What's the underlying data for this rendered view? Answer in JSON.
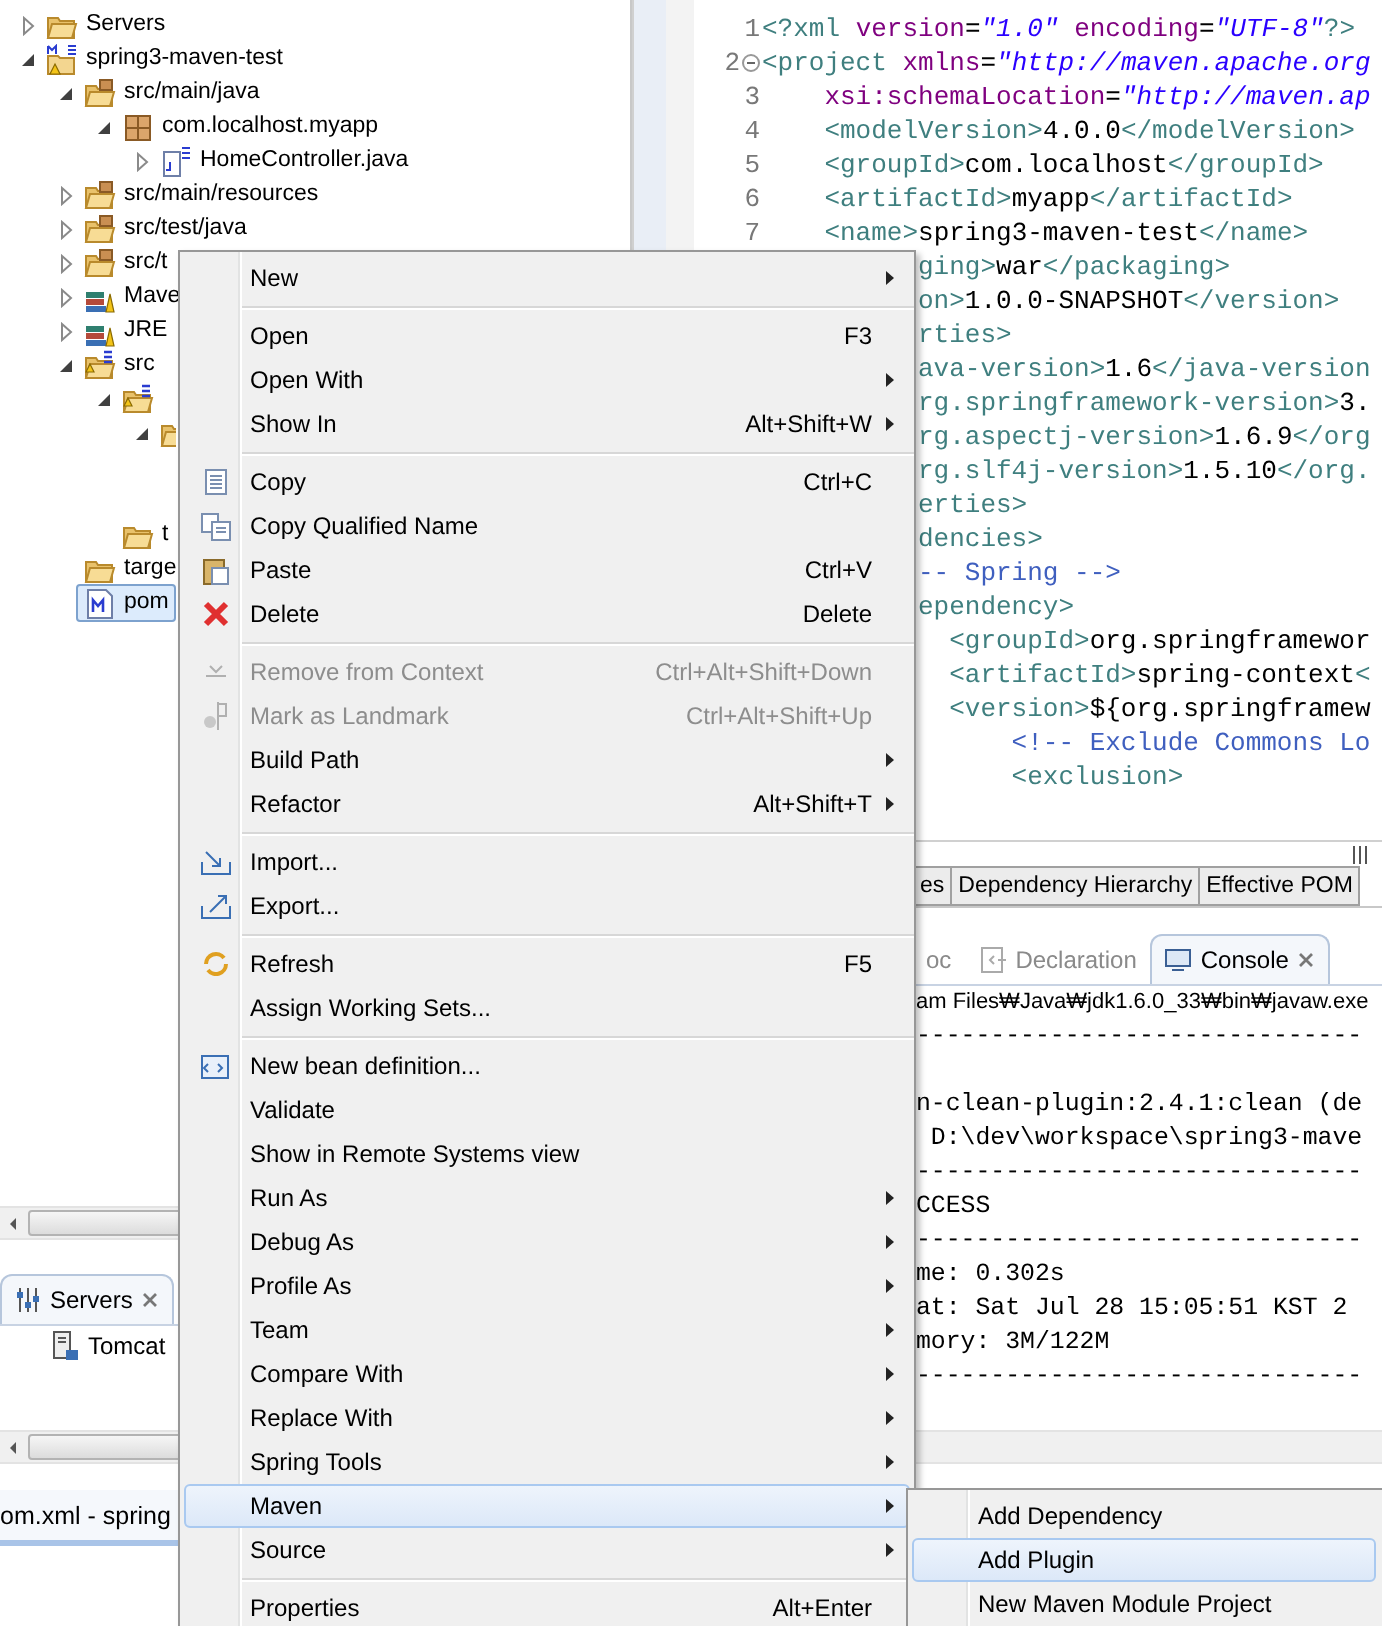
{
  "project_explorer": {
    "tree": [
      {
        "label": "Servers",
        "kind": "folder",
        "expanded": false,
        "selected": false
      },
      {
        "label": "spring3-maven-test",
        "kind": "project",
        "expanded": true,
        "selected": false,
        "children": [
          {
            "label": "src/main/java",
            "kind": "source-folder",
            "expanded": true,
            "selected": false,
            "children": [
              {
                "label": "com.localhost.myapp",
                "kind": "package",
                "expanded": true,
                "selected": false,
                "children": [
                  {
                    "label": "HomeController.java",
                    "kind": "java",
                    "expanded": false,
                    "selected": false
                  }
                ]
              }
            ]
          },
          {
            "label": "src/main/resources",
            "kind": "source-folder",
            "expanded": false,
            "selected": false
          },
          {
            "label": "src/test/java",
            "kind": "source-folder",
            "expanded": false,
            "selected": false
          },
          {
            "label": "src/t",
            "kind": "source-folder",
            "expanded": false,
            "selected": false
          },
          {
            "label": "Mave",
            "kind": "library",
            "expanded": false,
            "selected": false
          },
          {
            "label": "JRE",
            "kind": "library",
            "expanded": false,
            "selected": false
          },
          {
            "label": "src",
            "kind": "spring-folder",
            "expanded": true,
            "selected": false,
            "children": [
              {
                "kind": "spring-folder",
                "expanded": true,
                "selected": false,
                "children": [
                  {
                    "kind": "folder",
                    "expanded": true,
                    "selected": false
                  }
                ]
              },
              {
                "label": "t",
                "kind": "folder",
                "selected": false,
                "spacer_before": true
              }
            ]
          },
          {
            "label": "targe",
            "kind": "folder",
            "selected": false
          },
          {
            "label": "pom",
            "kind": "pom",
            "selected": true
          }
        ]
      }
    ]
  },
  "servers_view": {
    "tab": {
      "label": "Servers",
      "selected": true
    },
    "items": [
      {
        "label": "Tomcat"
      }
    ]
  },
  "editor": {
    "lines": [
      {
        "number": "1",
        "segments": [
          {
            "kind": "tag",
            "text": "<?xml"
          },
          {
            "kind": "attr",
            "text": " version"
          },
          {
            "kind": "text",
            "text": "="
          },
          {
            "kind": "value",
            "text": "\"1.0\""
          },
          {
            "kind": "attr",
            "text": " encoding"
          },
          {
            "kind": "text",
            "text": "="
          },
          {
            "kind": "value",
            "text": "\"UTF-8\""
          },
          {
            "kind": "tag",
            "text": "?>"
          }
        ]
      },
      {
        "number": "2",
        "expanded": true,
        "segments": [
          {
            "kind": "tag",
            "text": "<project"
          },
          {
            "kind": "attr",
            "text": " xmlns"
          },
          {
            "kind": "text",
            "text": "="
          },
          {
            "kind": "value",
            "text": "\"http://maven.apache.org"
          }
        ]
      },
      {
        "number": "3",
        "segments": [
          {
            "kind": "attr",
            "text": "    xsi:schemaLocation"
          },
          {
            "kind": "text",
            "text": "="
          },
          {
            "kind": "value",
            "text": "\"http://maven.ap"
          }
        ]
      },
      {
        "number": "4",
        "segments": [
          {
            "kind": "tag",
            "text": "    <modelVersion>"
          },
          {
            "kind": "text",
            "text": "4.0.0"
          },
          {
            "kind": "tag",
            "text": "</modelVersion>"
          }
        ]
      },
      {
        "number": "5",
        "segments": [
          {
            "kind": "tag",
            "text": "    <groupId>"
          },
          {
            "kind": "text",
            "text": "com.localhost"
          },
          {
            "kind": "tag",
            "text": "</groupId>"
          }
        ]
      },
      {
        "number": "6",
        "segments": [
          {
            "kind": "tag",
            "text": "    <artifactId>"
          },
          {
            "kind": "text",
            "text": "myapp"
          },
          {
            "kind": "tag",
            "text": "</artifactId>"
          }
        ]
      },
      {
        "number": "7",
        "segments": [
          {
            "kind": "tag",
            "text": "    <name>"
          },
          {
            "kind": "text",
            "text": "spring3-maven-test"
          },
          {
            "kind": "tag",
            "text": "</name>"
          }
        ]
      },
      {
        "segments": [
          {
            "kind": "tag",
            "text": "ging>"
          },
          {
            "kind": "text",
            "text": "war"
          },
          {
            "kind": "tag",
            "text": "</packaging>"
          }
        ]
      },
      {
        "segments": [
          {
            "kind": "tag",
            "text": "on>"
          },
          {
            "kind": "text",
            "text": "1.0.0-SNAPSHOT"
          },
          {
            "kind": "tag",
            "text": "</version>"
          }
        ]
      },
      {
        "segments": [
          {
            "kind": "tag",
            "text": "rties>"
          }
        ]
      },
      {
        "segments": [
          {
            "kind": "tag",
            "text": "ava-version>"
          },
          {
            "kind": "text",
            "text": "1.6"
          },
          {
            "kind": "tag",
            "text": "</java-version"
          }
        ]
      },
      {
        "segments": [
          {
            "kind": "tag",
            "text": "rg.springframework-version>"
          },
          {
            "kind": "text",
            "text": "3."
          }
        ]
      },
      {
        "segments": [
          {
            "kind": "tag",
            "text": "rg.aspectj-version>"
          },
          {
            "kind": "text",
            "text": "1.6.9"
          },
          {
            "kind": "tag",
            "text": "</org"
          }
        ]
      },
      {
        "segments": [
          {
            "kind": "tag",
            "text": "rg.slf4j-version>"
          },
          {
            "kind": "text",
            "text": "1.5.10"
          },
          {
            "kind": "tag",
            "text": "</org."
          }
        ]
      },
      {
        "segments": [
          {
            "kind": "tag",
            "text": "erties>"
          }
        ]
      },
      {
        "segments": [
          {
            "kind": "tag",
            "text": "dencies>"
          }
        ]
      },
      {
        "segments": [
          {
            "kind": "comment",
            "text": "-- Spring -->"
          }
        ]
      },
      {
        "segments": [
          {
            "kind": "tag",
            "text": "ependency>"
          }
        ]
      },
      {
        "segments": [
          {
            "kind": "tag",
            "text": "  <groupId>"
          },
          {
            "kind": "text",
            "text": "org.springframewor"
          }
        ]
      },
      {
        "segments": [
          {
            "kind": "tag",
            "text": "  <artifactId>"
          },
          {
            "kind": "text",
            "text": "spring-context"
          },
          {
            "kind": "tag",
            "text": "<"
          }
        ]
      },
      {
        "segments": [
          {
            "kind": "tag",
            "text": "  <version>"
          },
          {
            "kind": "text",
            "text": "${org.springframew"
          }
        ]
      },
      {
        "segments": [
          {
            "kind": "comment",
            "text": "      <!-- Exclude Commons Lo"
          }
        ]
      },
      {
        "segments": [
          {
            "kind": "tag",
            "text": "      <exclusion>"
          }
        ]
      }
    ],
    "tabs": [
      {
        "label": "es",
        "selected": false
      },
      {
        "label": "Dependency Hierarchy",
        "selected": false
      },
      {
        "label": "Effective POM",
        "selected": false
      }
    ]
  },
  "views": {
    "tabs": [
      {
        "label": "oc",
        "selected": false
      },
      {
        "label": "Declaration",
        "selected": false
      },
      {
        "label": "Console",
        "selected": true
      }
    ],
    "console_header": "am Files₩Java₩jdk1.6.0_33₩bin₩javaw.exe",
    "console_lines": [
      {
        "kind": "text",
        "text": "------------------------------"
      },
      {
        "kind": "blank"
      },
      {
        "kind": "text",
        "text": "n-clean-plugin:2.4.1:clean (de"
      },
      {
        "kind": "text",
        "text": " D:\\dev\\workspace\\spring3-mave"
      },
      {
        "kind": "text",
        "text": "------------------------------"
      },
      {
        "kind": "text",
        "text": "CCESS"
      },
      {
        "kind": "text",
        "text": "------------------------------"
      },
      {
        "kind": "text",
        "text": "me: 0.302s"
      },
      {
        "kind": "text",
        "text": "at: Sat Jul 28 15:05:51 KST 2"
      },
      {
        "kind": "text",
        "text": "mory: 3M/122M"
      },
      {
        "kind": "text",
        "text": "------------------------------"
      }
    ]
  },
  "status_bar": {
    "text": "om.xml - spring"
  },
  "context_menu": {
    "items": [
      {
        "kind": "item",
        "label": "New",
        "submenu": true,
        "disabled": false,
        "selected": false
      },
      {
        "kind": "separator"
      },
      {
        "kind": "item",
        "label": "Open",
        "shortcut": "F3",
        "submenu": false,
        "disabled": false,
        "selected": false
      },
      {
        "kind": "item",
        "label": "Open With",
        "submenu": true,
        "disabled": false,
        "selected": false
      },
      {
        "kind": "item",
        "label": "Show In",
        "shortcut": "Alt+Shift+W",
        "submenu": true,
        "disabled": false,
        "selected": false
      },
      {
        "kind": "separator"
      },
      {
        "kind": "item",
        "label": "Copy",
        "shortcut": "Ctrl+C",
        "submenu": false,
        "disabled": false,
        "selected": false
      },
      {
        "kind": "item",
        "label": "Copy Qualified Name",
        "submenu": false,
        "disabled": false,
        "selected": false
      },
      {
        "kind": "item",
        "label": "Paste",
        "shortcut": "Ctrl+V",
        "submenu": false,
        "disabled": false,
        "selected": false
      },
      {
        "kind": "item",
        "label": "Delete",
        "shortcut": "Delete",
        "submenu": false,
        "disabled": false,
        "selected": false
      },
      {
        "kind": "separator"
      },
      {
        "kind": "item",
        "label": "Remove from Context",
        "shortcut": "Ctrl+Alt+Shift+Down",
        "submenu": false,
        "disabled": true,
        "selected": false
      },
      {
        "kind": "item",
        "label": "Mark as Landmark",
        "shortcut": "Ctrl+Alt+Shift+Up",
        "submenu": false,
        "disabled": true,
        "selected": false
      },
      {
        "kind": "item",
        "label": "Build Path",
        "submenu": true,
        "disabled": false,
        "selected": false
      },
      {
        "kind": "item",
        "label": "Refactor",
        "shortcut": "Alt+Shift+T",
        "submenu": true,
        "disabled": false,
        "selected": false
      },
      {
        "kind": "separator"
      },
      {
        "kind": "item",
        "label": "Import...",
        "submenu": false,
        "disabled": false,
        "selected": false
      },
      {
        "kind": "item",
        "label": "Export...",
        "submenu": false,
        "disabled": false,
        "selected": false
      },
      {
        "kind": "separator"
      },
      {
        "kind": "item",
        "label": "Refresh",
        "shortcut": "F5",
        "submenu": false,
        "disabled": false,
        "selected": false
      },
      {
        "kind": "item",
        "label": "Assign Working Sets...",
        "submenu": false,
        "disabled": false,
        "selected": false
      },
      {
        "kind": "separator"
      },
      {
        "kind": "item",
        "label": "New bean definition...",
        "submenu": false,
        "disabled": false,
        "selected": false
      },
      {
        "kind": "item",
        "label": "Validate",
        "submenu": false,
        "disabled": false,
        "selected": false
      },
      {
        "kind": "item",
        "label": "Show in Remote Systems view",
        "submenu": false,
        "disabled": false,
        "selected": false
      },
      {
        "kind": "item",
        "label": "Run As",
        "submenu": true,
        "disabled": false,
        "selected": false
      },
      {
        "kind": "item",
        "label": "Debug As",
        "submenu": true,
        "disabled": false,
        "selected": false
      },
      {
        "kind": "item",
        "label": "Profile As",
        "submenu": true,
        "disabled": false,
        "selected": false
      },
      {
        "kind": "item",
        "label": "Team",
        "submenu": true,
        "disabled": false,
        "selected": false
      },
      {
        "kind": "item",
        "label": "Compare With",
        "submenu": true,
        "disabled": false,
        "selected": false
      },
      {
        "kind": "item",
        "label": "Replace With",
        "submenu": true,
        "disabled": false,
        "selected": false
      },
      {
        "kind": "item",
        "label": "Spring Tools",
        "submenu": true,
        "disabled": false,
        "selected": false
      },
      {
        "kind": "item",
        "label": "Maven",
        "submenu": true,
        "disabled": false,
        "selected": true
      },
      {
        "kind": "item",
        "label": "Source",
        "submenu": true,
        "disabled": false,
        "selected": false
      },
      {
        "kind": "separator"
      },
      {
        "kind": "item",
        "label": "Properties",
        "shortcut": "Alt+Enter",
        "submenu": false,
        "disabled": false,
        "selected": false
      }
    ]
  },
  "submenu": {
    "items": [
      {
        "label": "Add Dependency",
        "selected": false
      },
      {
        "label": "Add Plugin",
        "selected": true
      },
      {
        "label": "New Maven Module Project",
        "selected": false
      }
    ]
  }
}
